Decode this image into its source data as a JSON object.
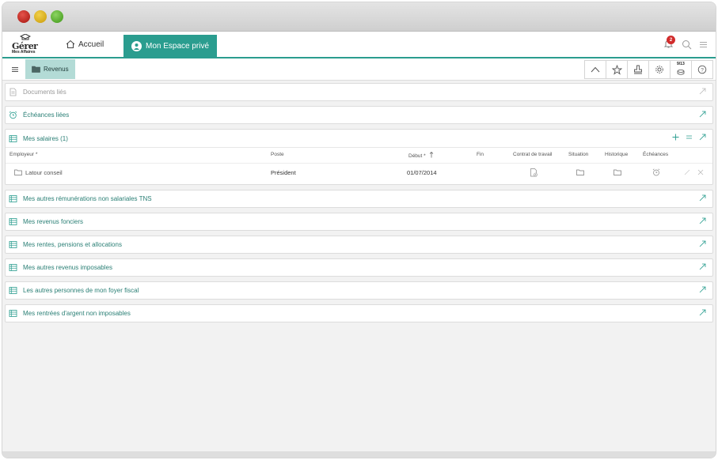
{
  "nav": {
    "logo_main": "Gérer",
    "logo_sub": "Mes Affaires",
    "home_label": "Accueil",
    "active_tab": "Mon Espace privé",
    "notif_count": "2"
  },
  "toolbar": {
    "breadcrumb": "Revenus",
    "counter": "9/13",
    "icons": [
      "chevron-up-icon",
      "star-icon",
      "stamp-icon",
      "gear-icon",
      "coins-icon",
      "help-icon"
    ]
  },
  "panels": {
    "docs": "Documents liés",
    "echeances": "Échéances liées",
    "autres_remun": "Mes autres rémunérations non salariales TNS",
    "fonciers": "Mes revenus fonciers",
    "rentes": "Mes rentes, pensions et allocations",
    "imposables": "Mes autres revenus imposables",
    "foyer": "Les autres personnes de mon foyer fiscal",
    "non_imposables": "Mes rentrées d'argent non imposables"
  },
  "salaires": {
    "title": "Mes salaires (1)",
    "columns": {
      "employeur": "Employeur *",
      "poste": "Poste",
      "debut": "Début *",
      "fin": "Fin",
      "contrat": "Contrat de travail",
      "situation": "Situation",
      "historique": "Historique",
      "echeances": "Échéances"
    },
    "rows": [
      {
        "employeur": "Latour conseil",
        "poste": "Président",
        "debut": "01/07/2014",
        "fin": ""
      }
    ]
  },
  "colors": {
    "accent": "#2a9d8f",
    "breadcrumb_bg": "#b3dbd6",
    "badge": "#d12c2c"
  }
}
